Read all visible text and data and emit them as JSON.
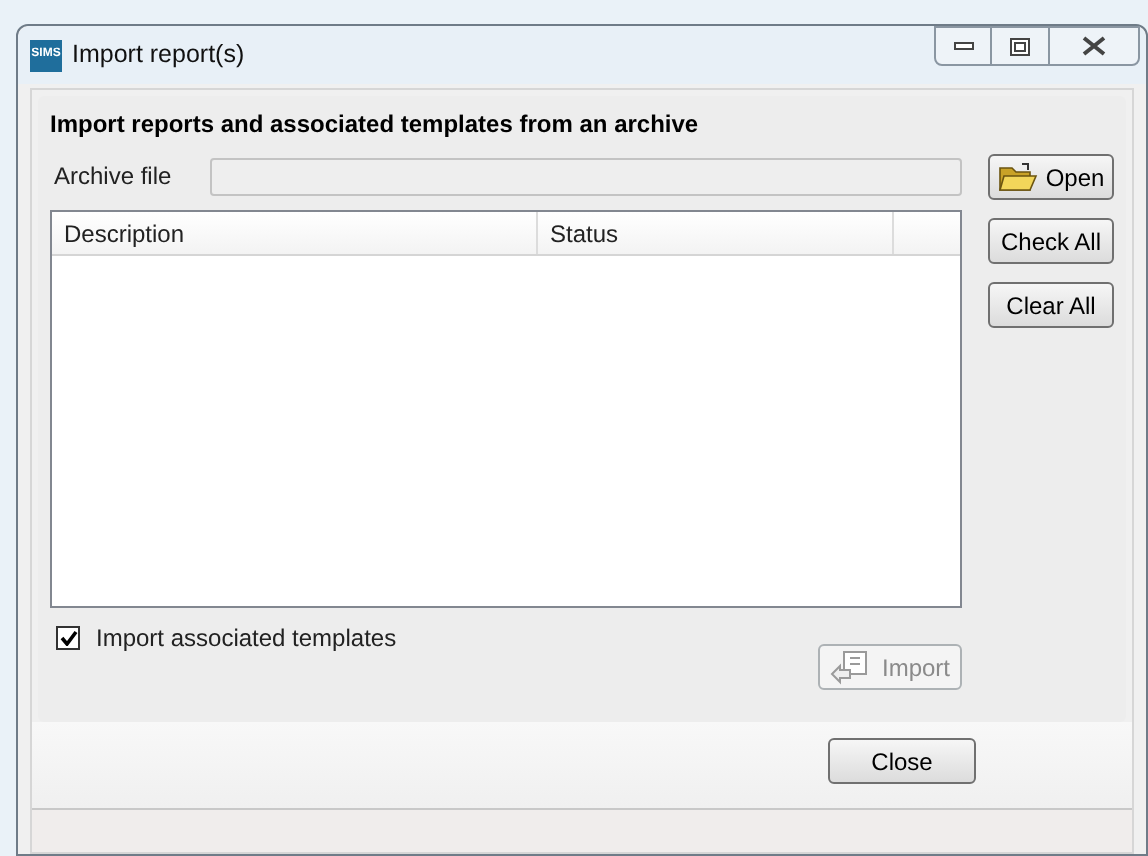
{
  "window": {
    "title": "Import report(s)",
    "logo": "SIMS"
  },
  "section_title": "Import reports and associated templates from an archive",
  "archive_field": {
    "label": "Archive file"
  },
  "buttons": [
    {
      "label": "Open",
      "kind": "open",
      "disabled": false
    },
    {
      "label": "Check All",
      "kind": "plain",
      "disabled": false
    },
    {
      "label": "Clear All",
      "kind": "plain",
      "disabled": false
    }
  ],
  "table": {
    "columns": [
      "Description",
      "Status"
    ]
  },
  "import_templates": {
    "label": "Import associated templates",
    "checked": true
  },
  "import_button": {
    "label": "Import",
    "disabled": true
  },
  "close_button": {
    "label": "Close"
  }
}
